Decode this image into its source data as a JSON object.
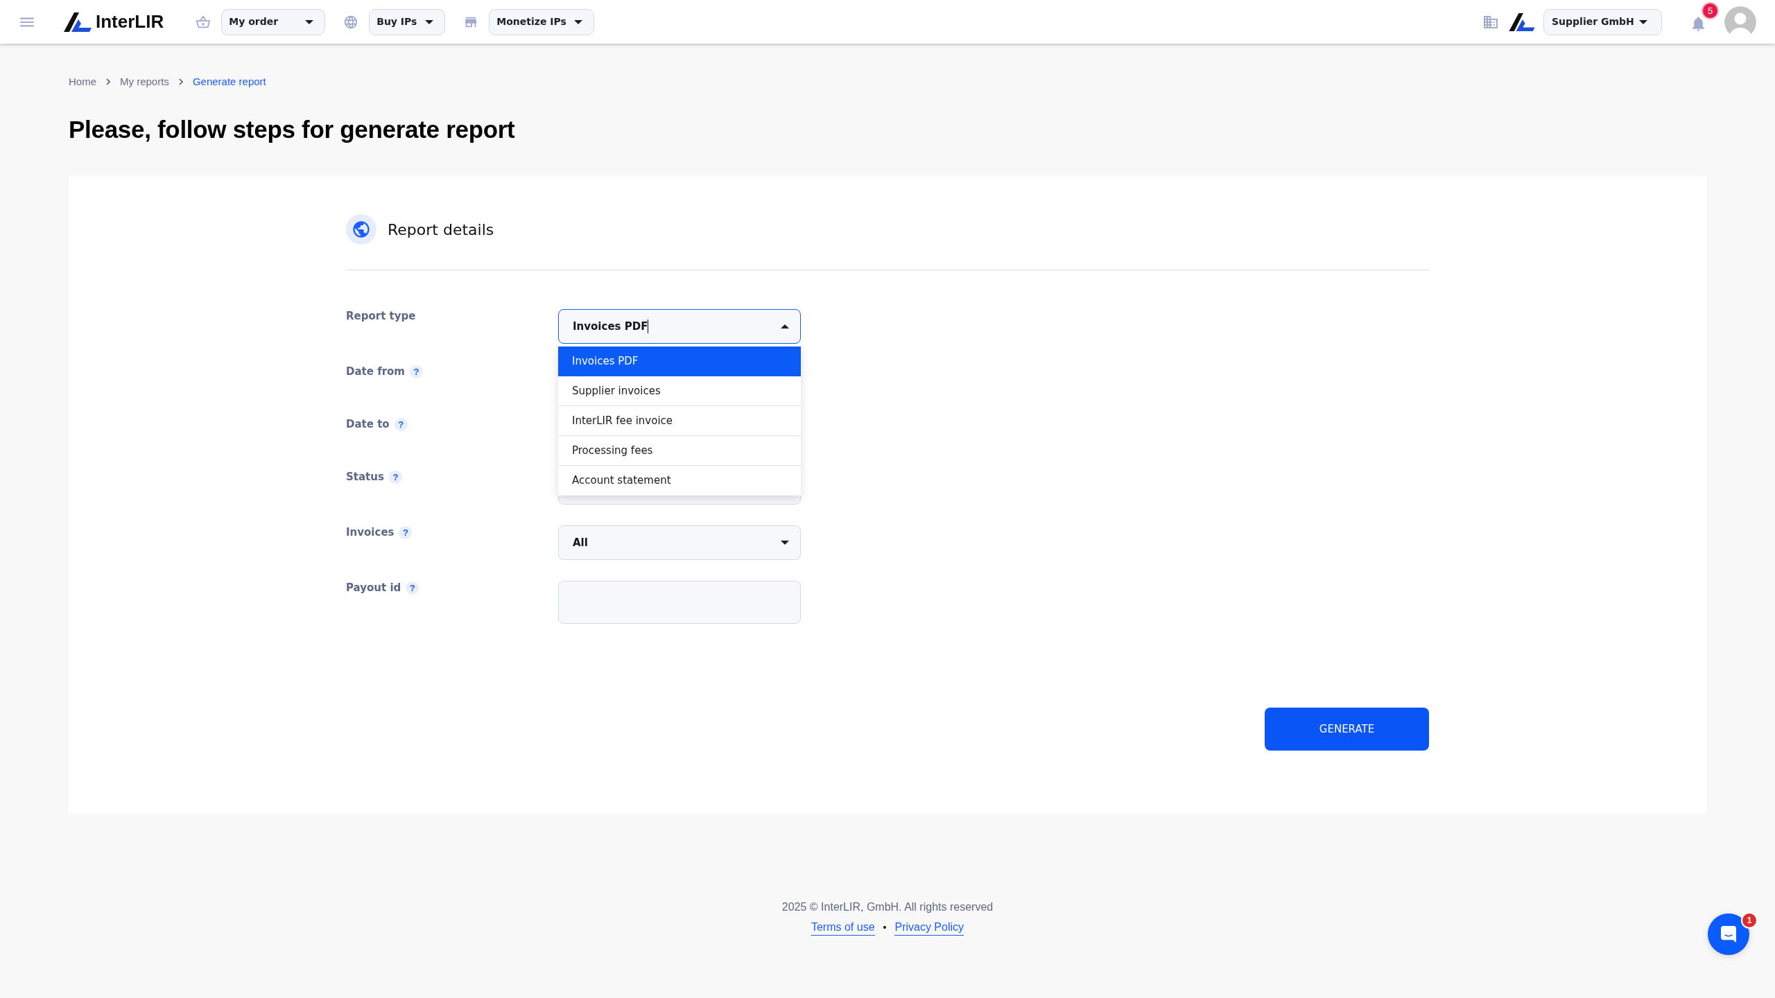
{
  "header": {
    "brand": "InterLIR",
    "nav": [
      {
        "label": "My order"
      },
      {
        "label": "Buy IPs"
      },
      {
        "label": "Monetize IPs"
      }
    ],
    "company": {
      "label": "Supplier GmbH"
    },
    "notifications": {
      "count": "5"
    }
  },
  "breadcrumb": [
    {
      "label": "Home",
      "selected": false
    },
    {
      "label": "My reports",
      "selected": false
    },
    {
      "label": "Generate report",
      "selected": true
    }
  ],
  "page_title": "Please, follow steps for generate report",
  "section": {
    "title": "Report details"
  },
  "form": {
    "fields": [
      {
        "kind": "select",
        "label": "Report type",
        "value": "Invoices PDF",
        "focused": true,
        "expanded": true,
        "options": [
          {
            "label": "Invoices PDF",
            "selected": true
          },
          {
            "label": "Supplier invoices",
            "selected": false
          },
          {
            "label": "InterLIR fee invoice",
            "selected": false
          },
          {
            "label": "Processing fees",
            "selected": false
          },
          {
            "label": "Account statement",
            "selected": false
          }
        ]
      },
      {
        "kind": "covered",
        "label": "Date from",
        "help": "?"
      },
      {
        "kind": "covered",
        "label": "Date to",
        "help": "?"
      },
      {
        "kind": "select",
        "label": "Status",
        "help": "?"
      },
      {
        "kind": "select",
        "label": "Invoices",
        "help": "?",
        "value": "All",
        "focused": false,
        "expanded": false
      },
      {
        "kind": "text",
        "label": "Payout id",
        "help": "?"
      }
    ]
  },
  "generate_button": "GENERATE",
  "footer": {
    "copyright": "2025 © InterLIR, GmbH. All rights reserved",
    "links": [
      "Terms of use",
      "Privacy Policy"
    ],
    "separator": "•"
  },
  "chat": {
    "badge": "1"
  }
}
